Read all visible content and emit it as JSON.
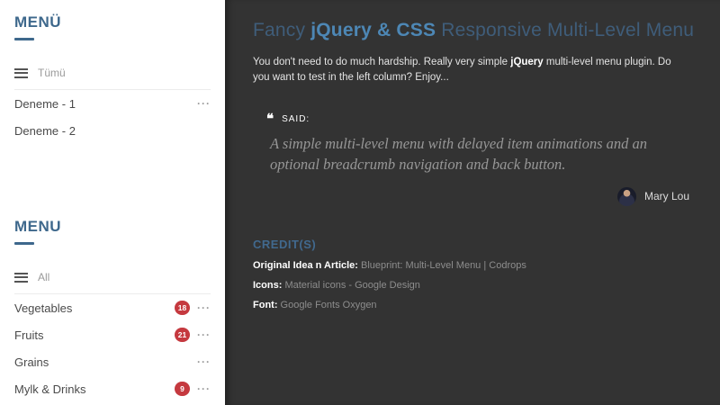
{
  "icons": {
    "quote_glyph": "❝",
    "more_glyph": "···"
  },
  "sidebar": {
    "menu_tr": {
      "title": "MENÜ",
      "filter_label": "Tümü",
      "items": [
        {
          "label": "Deneme - 1"
        },
        {
          "label": "Deneme - 2"
        }
      ]
    },
    "menu_en": {
      "title": "MENU",
      "filter_label": "All",
      "items": [
        {
          "label": "Vegetables",
          "badge": "18"
        },
        {
          "label": "Fruits",
          "badge": "21"
        },
        {
          "label": "Grains"
        },
        {
          "label": "Mylk & Drinks",
          "badge": "9"
        }
      ]
    }
  },
  "main": {
    "title": {
      "prefix": "Fancy ",
      "accent": "jQuery & CSS",
      "suffix": " Responsive Multi-Level Menu"
    },
    "intro": {
      "before_bold": "You don't need to do much hardship. Really very simple ",
      "bold": "jQuery",
      "after_bold": " multi-level menu plugin. Do you want to test in the left column? Enjoy..."
    },
    "quote": {
      "label": "SAID:",
      "text": "A simple multi-level menu with delayed item animations and an optional breadcrumb navigation and back button.",
      "author": "Mary Lou"
    },
    "credits": {
      "heading": "CREDIT(S)",
      "rows": [
        {
          "label": "Original Idea n Article:",
          "value": "Blueprint: Multi-Level Menu | Codrops"
        },
        {
          "label": "Icons:",
          "value": "Material icons - Google Design"
        },
        {
          "label": "Font:",
          "value": "Google Fonts Oxygen"
        }
      ]
    }
  },
  "colors": {
    "accent_blue": "#4d87b5",
    "muted_blue": "#3f5d7a",
    "heading_blue": "#3e688c",
    "badge_red": "#c5393f",
    "panel_bg": "#333333",
    "sidebar_bg": "#ffffff"
  }
}
